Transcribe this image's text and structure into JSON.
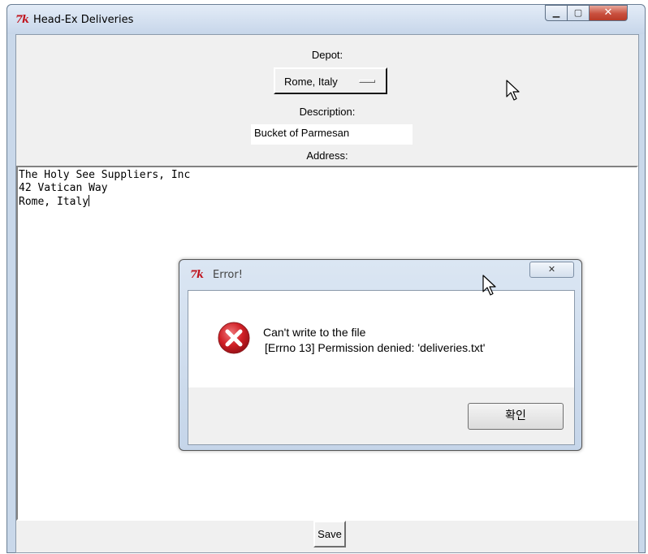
{
  "window": {
    "title": "Head-Ex Deliveries",
    "app_icon": "tk-feather-icon",
    "controls": {
      "minimize": "minimize-icon",
      "maximize": "maximize-icon",
      "close": "close-icon"
    }
  },
  "form": {
    "depot_label": "Depot:",
    "depot_value": "Rome, Italy",
    "description_label": "Description:",
    "description_value": "Bucket of Parmesan",
    "address_label": "Address:",
    "address_lines": [
      "The Holy See Suppliers, Inc",
      "42 Vatican Way",
      "Rome, Italy"
    ],
    "save_label": "Save"
  },
  "dialog": {
    "title": "Error!",
    "icon": "error-icon",
    "message_line1": "Can't write to the file",
    "message_line2": "[Errno 13] Permission denied: 'deliveries.txt'",
    "ok_label": "확인"
  },
  "colors": {
    "tk_logo": "#c0141e",
    "error_red": "#d01f25",
    "close_button": "#c9503e",
    "title_bar": "#c7d6ea"
  }
}
